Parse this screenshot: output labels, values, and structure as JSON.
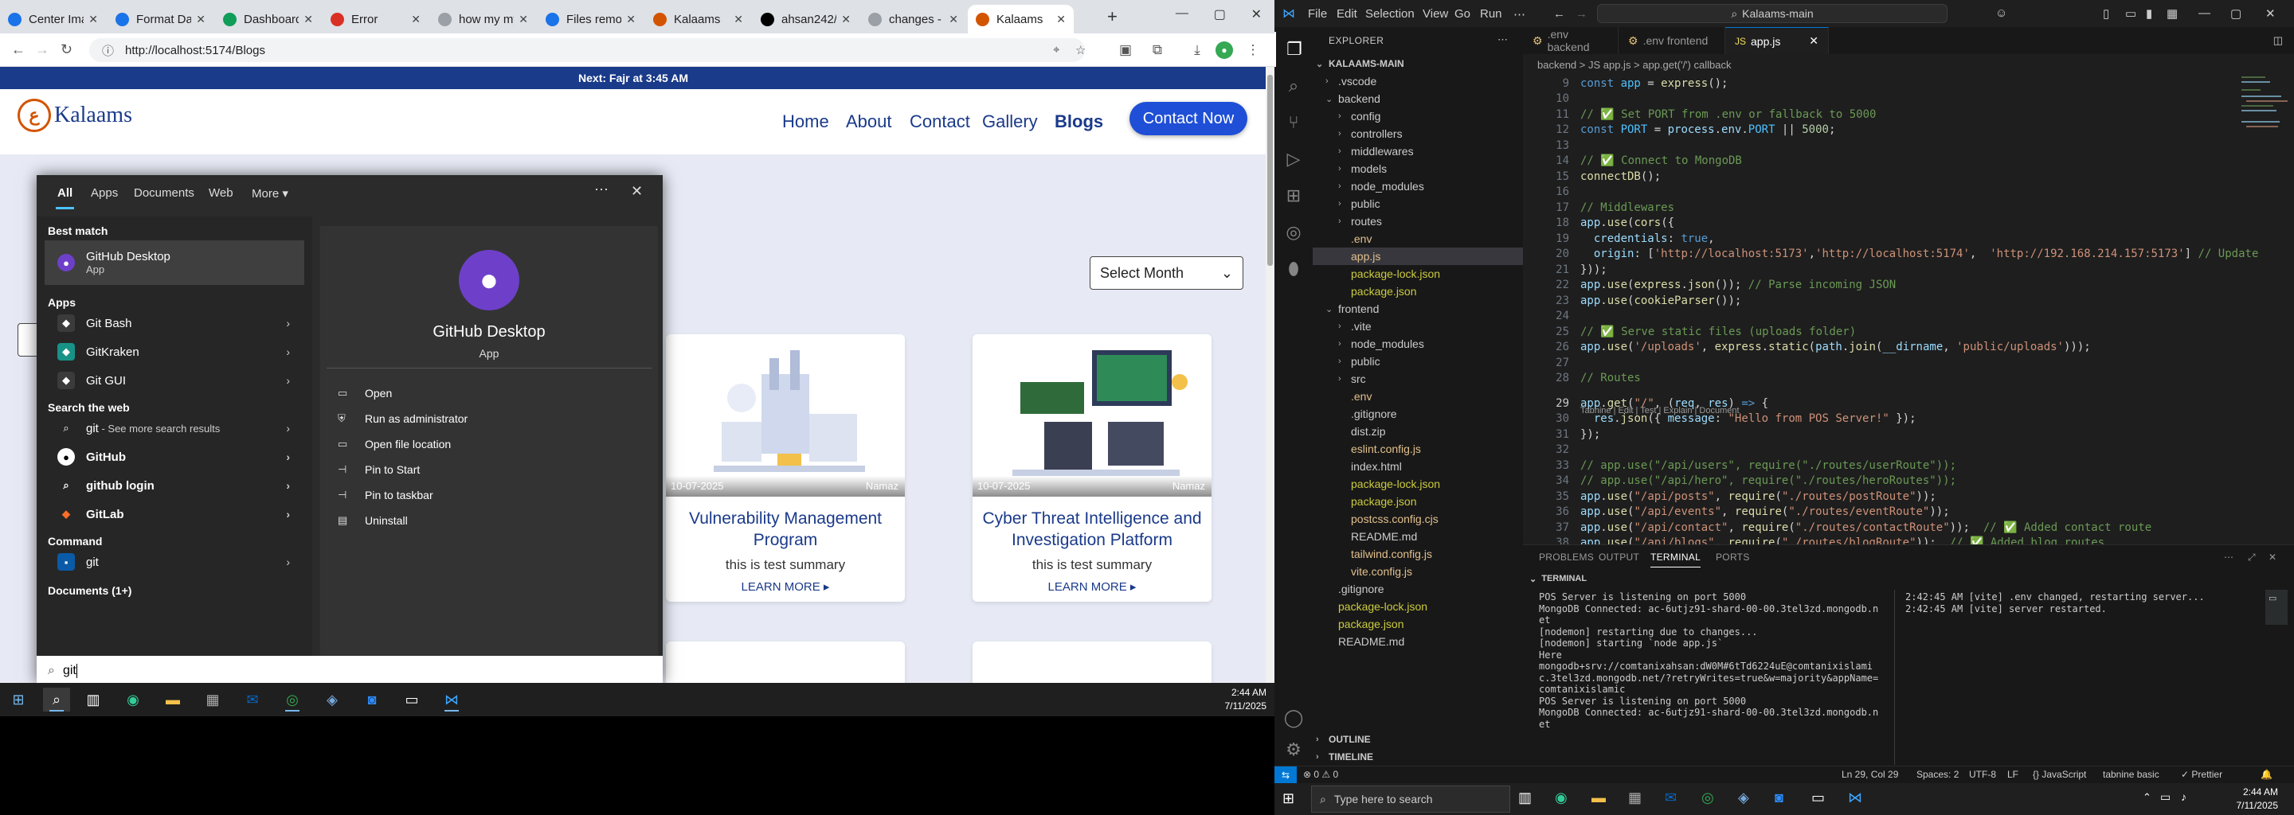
{
  "browser": {
    "tabs": [
      {
        "label": "Center Ima",
        "color": "#1a73e8"
      },
      {
        "label": "Format Dat",
        "color": "#1a73e8"
      },
      {
        "label": "Dashboard",
        "color": "#0f9d58"
      },
      {
        "label": "Error",
        "color": "#d93025"
      },
      {
        "label": "how my my",
        "color": "#9aa0a6"
      },
      {
        "label": "Files remov",
        "color": "#1a73e8"
      },
      {
        "label": "Kalaams",
        "color": "#d35400"
      },
      {
        "label": "ahsan242/",
        "color": "#000000"
      },
      {
        "label": "changes - a",
        "color": "#9aa0a6"
      },
      {
        "label": "Kalaams",
        "color": "#d35400"
      }
    ],
    "url": "http://localhost:5174/Blogs"
  },
  "site": {
    "announcement": "Next: Fajr at 3:45 AM",
    "logo_text": "Kalaams",
    "nav": [
      "Home",
      "About",
      "Contact",
      "Gallery",
      "Blogs"
    ],
    "contact_button": "Contact Now",
    "select_month": "Select Month",
    "cards": [
      {
        "date": "10-07-2025",
        "author": "Namaz",
        "title": "Vulnerability Management Program",
        "summary": "this is test summary",
        "more": "LEARN MORE"
      },
      {
        "date": "10-07-2025",
        "author": "Namaz",
        "title": "Cyber Threat Intelligence and Investigation Platform",
        "summary": "this is test summary",
        "more": "LEARN MORE"
      }
    ]
  },
  "search": {
    "tabs": [
      "All",
      "Apps",
      "Documents",
      "Web",
      "More"
    ],
    "best_match_header": "Best match",
    "best_match": {
      "name": "GitHub Desktop",
      "type": "App"
    },
    "apps_header": "Apps",
    "apps": [
      "Git Bash",
      "GitKraken",
      "Git GUI"
    ],
    "web_header": "Search the web",
    "web": [
      {
        "label": "git",
        "suffix": " - See more search results"
      },
      {
        "label": "GitHub",
        "suffix": ""
      },
      {
        "label": "github login",
        "suffix": ""
      },
      {
        "label": "GitLab",
        "suffix": ""
      }
    ],
    "command_header": "Command",
    "command": "git",
    "documents": "Documents (1+)",
    "detail_name": "GitHub Desktop",
    "detail_type": "App",
    "actions": [
      "Open",
      "Run as administrator",
      "Open file location",
      "Pin to Start",
      "Pin to taskbar",
      "Uninstall"
    ],
    "query": "git"
  },
  "taskbar_left": {
    "time": "2:44 AM",
    "date": "7/11/2025"
  },
  "vscode": {
    "menu": [
      "File",
      "Edit",
      "Selection",
      "View",
      "Go",
      "Run"
    ],
    "search": "Kalaams-main",
    "explorer_title": "EXPLORER",
    "root": "KALAAMS-MAIN",
    "tree": [
      {
        "label": ".vscode",
        "depth": 1,
        "folder": true,
        "open": false
      },
      {
        "label": "backend",
        "depth": 1,
        "folder": true,
        "open": true
      },
      {
        "label": "config",
        "depth": 2,
        "folder": true,
        "open": false
      },
      {
        "label": "controllers",
        "depth": 2,
        "folder": true,
        "open": false
      },
      {
        "label": "middlewares",
        "depth": 2,
        "folder": true,
        "open": false
      },
      {
        "label": "models",
        "depth": 2,
        "folder": true,
        "open": false
      },
      {
        "label": "node_modules",
        "depth": 2,
        "folder": true,
        "open": false
      },
      {
        "label": "public",
        "depth": 2,
        "folder": true,
        "open": false
      },
      {
        "label": "routes",
        "depth": 2,
        "folder": true,
        "open": false
      },
      {
        "label": ".env",
        "depth": 2,
        "folder": false
      },
      {
        "label": "app.js",
        "depth": 2,
        "folder": false,
        "selected": true
      },
      {
        "label": "package-lock.json",
        "depth": 2,
        "folder": false
      },
      {
        "label": "package.json",
        "depth": 2,
        "folder": false
      },
      {
        "label": "frontend",
        "depth": 1,
        "folder": true,
        "open": true
      },
      {
        "label": ".vite",
        "depth": 2,
        "folder": true,
        "open": false
      },
      {
        "label": "node_modules",
        "depth": 2,
        "folder": true,
        "open": false
      },
      {
        "label": "public",
        "depth": 2,
        "folder": true,
        "open": false
      },
      {
        "label": "src",
        "depth": 2,
        "folder": true,
        "open": false
      },
      {
        "label": ".env",
        "depth": 2,
        "folder": false
      },
      {
        "label": ".gitignore",
        "depth": 2,
        "folder": false
      },
      {
        "label": "dist.zip",
        "depth": 2,
        "folder": false
      },
      {
        "label": "eslint.config.js",
        "depth": 2,
        "folder": false
      },
      {
        "label": "index.html",
        "depth": 2,
        "folder": false
      },
      {
        "label": "package-lock.json",
        "depth": 2,
        "folder": false
      },
      {
        "label": "package.json",
        "depth": 2,
        "folder": false
      },
      {
        "label": "postcss.config.cjs",
        "depth": 2,
        "folder": false
      },
      {
        "label": "README.md",
        "depth": 2,
        "folder": false
      },
      {
        "label": "tailwind.config.js",
        "depth": 2,
        "folder": false
      },
      {
        "label": "vite.config.js",
        "depth": 2,
        "folder": false
      },
      {
        "label": ".gitignore",
        "depth": 1,
        "folder": false
      },
      {
        "label": "package-lock.json",
        "depth": 1,
        "folder": false
      },
      {
        "label": "package.json",
        "depth": 1,
        "folder": false
      },
      {
        "label": "README.md",
        "depth": 1,
        "folder": false
      }
    ],
    "outline": "OUTLINE",
    "timeline": "TIMELINE",
    "editor_tabs": [
      ".env backend",
      ".env frontend",
      "app.js"
    ],
    "breadcrumb": "backend  >  JS app.js  >  app.get('/') callback",
    "codelens": "Tabnine | Edit | Test | Explain | Document",
    "code": [
      {
        "n": "9",
        "t": [
          [
            "kw",
            "const "
          ],
          [
            "cn",
            "app"
          ],
          [
            "pl",
            " = "
          ],
          [
            "fn",
            "express"
          ],
          [
            "pl",
            "();"
          ]
        ]
      },
      {
        "n": "10",
        "t": []
      },
      {
        "n": "11",
        "t": [
          [
            "cm",
            "// ✅ Set PORT from .env or fallback to 5000"
          ]
        ]
      },
      {
        "n": "12",
        "t": [
          [
            "kw",
            "const "
          ],
          [
            "cn",
            "PORT"
          ],
          [
            "pl",
            " = "
          ],
          [
            "vr",
            "process"
          ],
          [
            "pl",
            "."
          ],
          [
            "vr",
            "env"
          ],
          [
            "pl",
            "."
          ],
          [
            "cn",
            "PORT"
          ],
          [
            "pl",
            " || "
          ],
          [
            "nm",
            "5000"
          ],
          [
            "pl",
            ";"
          ]
        ]
      },
      {
        "n": "13",
        "t": []
      },
      {
        "n": "14",
        "t": [
          [
            "cm",
            "// ✅ Connect to MongoDB"
          ]
        ]
      },
      {
        "n": "15",
        "t": [
          [
            "fn",
            "connectDB"
          ],
          [
            "pl",
            "();"
          ]
        ]
      },
      {
        "n": "16",
        "t": []
      },
      {
        "n": "17",
        "t": [
          [
            "cm",
            "// Middlewares"
          ]
        ]
      },
      {
        "n": "18",
        "t": [
          [
            "vr",
            "app"
          ],
          [
            "pl",
            "."
          ],
          [
            "fn",
            "use"
          ],
          [
            "pl",
            "("
          ],
          [
            "fn",
            "cors"
          ],
          [
            "pl",
            "({"
          ]
        ]
      },
      {
        "n": "19",
        "t": [
          [
            "vr",
            "  credentials"
          ],
          [
            "pl",
            ": "
          ],
          [
            "kw",
            "true"
          ],
          [
            "pl",
            ","
          ]
        ]
      },
      {
        "n": "20",
        "t": [
          [
            "vr",
            "  origin"
          ],
          [
            "pl",
            ": ["
          ],
          [
            "st",
            "'http://localhost:5173'"
          ],
          [
            "pl",
            ","
          ],
          [
            "st",
            "'http://localhost:5174'"
          ],
          [
            "pl",
            ",  "
          ],
          [
            "st",
            "'http://192.168.214.157:5173'"
          ],
          [
            "pl",
            "] "
          ],
          [
            "cm",
            "// Update"
          ]
        ]
      },
      {
        "n": "21",
        "t": [
          [
            "pl",
            "}));"
          ]
        ]
      },
      {
        "n": "22",
        "t": [
          [
            "vr",
            "app"
          ],
          [
            "pl",
            "."
          ],
          [
            "fn",
            "use"
          ],
          [
            "pl",
            "("
          ],
          [
            "fn",
            "express"
          ],
          [
            "pl",
            "."
          ],
          [
            "fn",
            "json"
          ],
          [
            "pl",
            "()); "
          ],
          [
            "cm",
            "// Parse incoming JSON"
          ]
        ]
      },
      {
        "n": "23",
        "t": [
          [
            "vr",
            "app"
          ],
          [
            "pl",
            "."
          ],
          [
            "fn",
            "use"
          ],
          [
            "pl",
            "("
          ],
          [
            "fn",
            "cookieParser"
          ],
          [
            "pl",
            "());"
          ]
        ]
      },
      {
        "n": "24",
        "t": []
      },
      {
        "n": "25",
        "t": [
          [
            "cm",
            "// ✅ Serve static files (uploads folder)"
          ]
        ]
      },
      {
        "n": "26",
        "t": [
          [
            "vr",
            "app"
          ],
          [
            "pl",
            "."
          ],
          [
            "fn",
            "use"
          ],
          [
            "pl",
            "("
          ],
          [
            "st",
            "'/uploads'"
          ],
          [
            "pl",
            ", "
          ],
          [
            "fn",
            "express"
          ],
          [
            "pl",
            "."
          ],
          [
            "fn",
            "static"
          ],
          [
            "pl",
            "("
          ],
          [
            "vr",
            "path"
          ],
          [
            "pl",
            "."
          ],
          [
            "fn",
            "join"
          ],
          [
            "pl",
            "("
          ],
          [
            "vr",
            "__dirname"
          ],
          [
            "pl",
            ", "
          ],
          [
            "st",
            "'public/uploads'"
          ],
          [
            "pl",
            ")));"
          ]
        ]
      },
      {
        "n": "27",
        "t": []
      },
      {
        "n": "28",
        "t": [
          [
            "cm",
            "// Routes"
          ]
        ]
      },
      {
        "n": "29",
        "t": [
          [
            "vr",
            "app"
          ],
          [
            "pl",
            "."
          ],
          [
            "fn",
            "get"
          ],
          [
            "pl",
            "("
          ],
          [
            "st",
            "\"/\""
          ],
          [
            "pl",
            ", ("
          ],
          [
            "vr",
            "req"
          ],
          [
            "pl",
            ", "
          ],
          [
            "vr",
            "res"
          ],
          [
            "pl",
            ") "
          ],
          [
            "kw",
            "=>"
          ],
          [
            "pl",
            " {"
          ]
        ]
      },
      {
        "n": "30",
        "t": [
          [
            "vr",
            "  res"
          ],
          [
            "pl",
            "."
          ],
          [
            "fn",
            "json"
          ],
          [
            "pl",
            "({ "
          ],
          [
            "vr",
            "message"
          ],
          [
            "pl",
            ": "
          ],
          [
            "st",
            "\"Hello from POS Server!\""
          ],
          [
            "pl",
            " });"
          ]
        ]
      },
      {
        "n": "31",
        "t": [
          [
            "pl",
            "});"
          ]
        ]
      },
      {
        "n": "32",
        "t": []
      },
      {
        "n": "33",
        "t": [
          [
            "cm",
            "// app.use(\"/api/users\", require(\"./routes/userRoute\"));"
          ]
        ]
      },
      {
        "n": "34",
        "t": [
          [
            "cm",
            "// app.use(\"/api/hero\", require(\"./routes/heroRoutes\"));"
          ]
        ]
      },
      {
        "n": "35",
        "t": [
          [
            "vr",
            "app"
          ],
          [
            "pl",
            "."
          ],
          [
            "fn",
            "use"
          ],
          [
            "pl",
            "("
          ],
          [
            "st",
            "\"/api/posts\""
          ],
          [
            "pl",
            ", "
          ],
          [
            "fn",
            "require"
          ],
          [
            "pl",
            "("
          ],
          [
            "st",
            "\"./routes/postRoute\""
          ],
          [
            "pl",
            "));"
          ]
        ]
      },
      {
        "n": "36",
        "t": [
          [
            "vr",
            "app"
          ],
          [
            "pl",
            "."
          ],
          [
            "fn",
            "use"
          ],
          [
            "pl",
            "("
          ],
          [
            "st",
            "\"/api/events\""
          ],
          [
            "pl",
            ", "
          ],
          [
            "fn",
            "require"
          ],
          [
            "pl",
            "("
          ],
          [
            "st",
            "\"./routes/eventRoute\""
          ],
          [
            "pl",
            "));"
          ]
        ]
      },
      {
        "n": "37",
        "t": [
          [
            "vr",
            "app"
          ],
          [
            "pl",
            "."
          ],
          [
            "fn",
            "use"
          ],
          [
            "pl",
            "("
          ],
          [
            "st",
            "\"/api/contact\""
          ],
          [
            "pl",
            ", "
          ],
          [
            "fn",
            "require"
          ],
          [
            "pl",
            "("
          ],
          [
            "st",
            "\"./routes/contactRoute\""
          ],
          [
            "pl",
            "));  "
          ],
          [
            "cm",
            "// ✅ Added contact route"
          ]
        ]
      },
      {
        "n": "38",
        "t": [
          [
            "vr",
            "app"
          ],
          [
            "pl",
            "."
          ],
          [
            "fn",
            "use"
          ],
          [
            "pl",
            "("
          ],
          [
            "st",
            "\"/api/blogs\""
          ],
          [
            "pl",
            ", "
          ],
          [
            "fn",
            "require"
          ],
          [
            "pl",
            "("
          ],
          [
            "st",
            "\"./routes/blogRoute\""
          ],
          [
            "pl",
            "));  "
          ],
          [
            "cm",
            "// ✅ Added blog routes"
          ]
        ]
      }
    ],
    "panel_tabs": [
      "PROBLEMS",
      "OUTPUT",
      "TERMINAL",
      "PORTS"
    ],
    "terminal_header": "TERMINAL",
    "terminal_left": "POS Server is listening on port 5000\nMongoDB Connected: ac-6utjz91-shard-00-00.3tel3zd.mongodb.n\net\n[nodemon] restarting due to changes...\n[nodemon] starting `node app.js`\nHere\nmongodb+srv://comtanixahsan:dW0M#6tTd6224uE@comtanixislami\nc.3tel3zd.mongodb.net/?retryWrites=true&w=majority&appName=\ncomtanixislamic\nPOS Server is listening on port 5000\nMongoDB Connected: ac-6utjz91-shard-00-00.3tel3zd.mongodb.n\net",
    "terminal_right": "2:42:45 AM [vite] .env changed, restarting server...\n2:42:45 AM [vite] server restarted.",
    "status": {
      "left": "⊗ 0 ⚠ 0",
      "position": "Ln 29, Col 29",
      "spaces": "Spaces: 2",
      "encoding": "UTF-8",
      "eol": "LF",
      "lang": "{} JavaScript",
      "tabnine": "tabnine basic",
      "prettier": "✓ Prettier"
    }
  },
  "taskbar_right": {
    "search": "Type here to search",
    "time": "2:44 AM",
    "date": "7/11/2025"
  }
}
